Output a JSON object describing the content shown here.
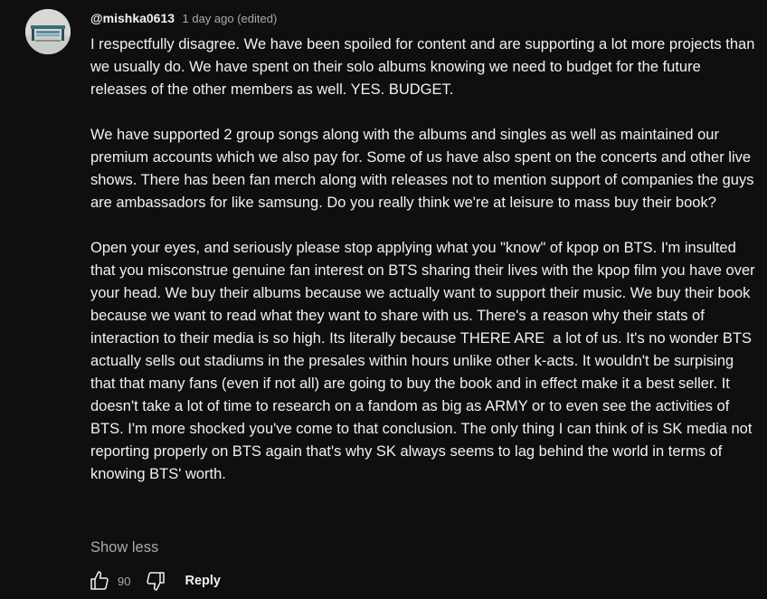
{
  "comment": {
    "author": "@mishka0613",
    "meta": "1 day ago (edited)",
    "paragraphs": [
      "I respectfully disagree. We have been spoiled for content and are supporting a lot more projects than we usually do. We have spent on their solo albums knowing we need to budget for the future releases of the other members as well. YES. BUDGET.",
      "We have supported 2 group songs along with the albums and singles as well as maintained our premium accounts which we also pay for. Some of us have also spent on the concerts and other live shows. There has been fan merch along with releases not to mention support of companies the guys are ambassadors for like samsung. Do you really think we're at leisure to mass buy their book?",
      "Open your eyes, and seriously please stop applying what you \"know\" of kpop on BTS. I'm insulted that you misconstrue genuine fan interest on BTS sharing their lives with the kpop film you have over your head. We buy their albums because we actually want to support their music. We buy their book because we want to read what they want to share with us. There's a reason why their stats of interaction to their media is so high. Its literally because THERE ARE  a lot of us. It's no wonder BTS actually sells out stadiums in the presales within hours unlike other k-acts. It wouldn't be surpising  that that many fans (even if not all) are going to buy the book and in effect make it a best seller. It doesn't take a lot of time to research on a fandom as big as ARMY or to even see the activities of BTS. I'm more shocked you've come to that conclusion. The only thing I can think of is SK media not reporting properly on BTS again that's why SK always seems to lag behind the world in terms of knowing BTS' worth."
    ],
    "show_less": "Show less",
    "like_count": "90",
    "reply_label": "Reply"
  },
  "icons": {
    "avatar": "avatar-image",
    "like": "thumbs-up-icon",
    "dislike": "thumbs-down-icon"
  },
  "colors": {
    "background": "#0f0f0f",
    "text": "#f1f1f1",
    "secondary_text": "#aaaaaa"
  }
}
